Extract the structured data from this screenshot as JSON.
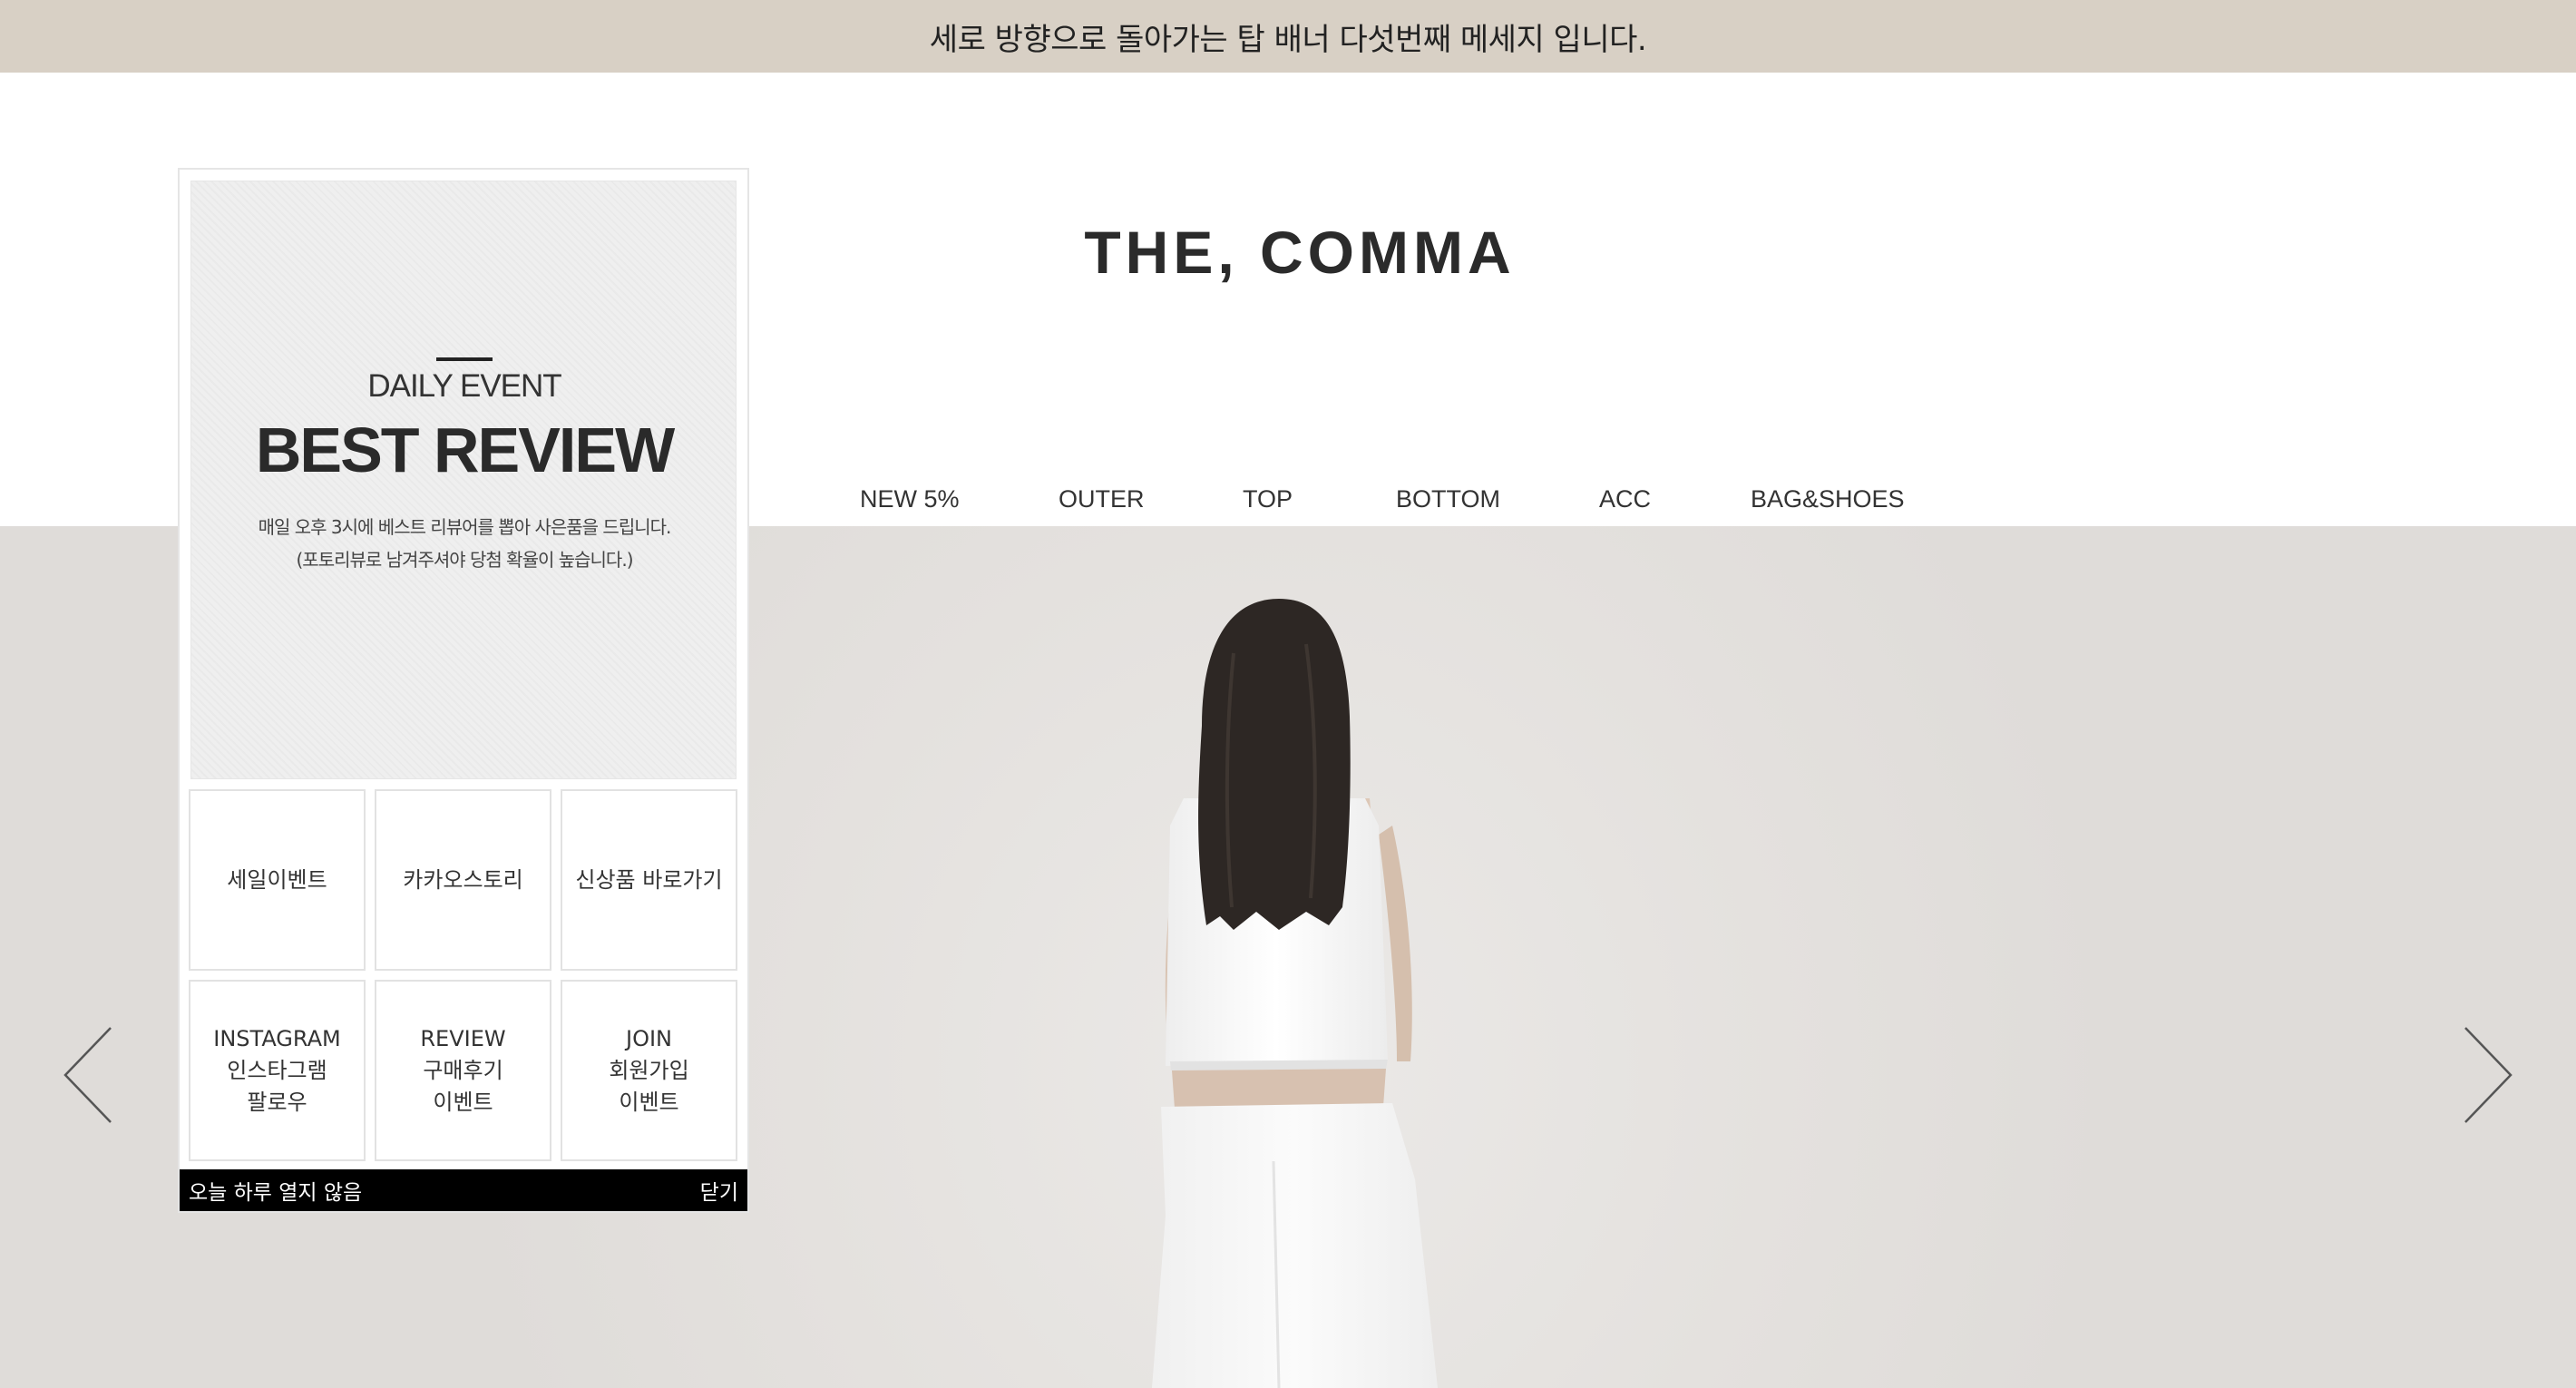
{
  "top_banner": {
    "text": "세로 방향으로 돌아가는 탑 배너 다섯번째 메세지 입니다."
  },
  "header": {
    "logo": "THE, COMMA",
    "nav": [
      {
        "label": "NEW 5%"
      },
      {
        "label": "OUTER"
      },
      {
        "label": "TOP"
      },
      {
        "label": "BOTTOM"
      },
      {
        "label": "ACC"
      },
      {
        "label": "BAG&SHOES"
      }
    ]
  },
  "hero": {
    "prev_icon": "chevron-left-icon",
    "next_icon": "chevron-right-icon",
    "colors": {
      "background": "#e4e1de",
      "arrow": "#555555"
    }
  },
  "popup": {
    "banner": {
      "kicker": "DAILY EVENT",
      "headline": "BEST REVIEW",
      "description": [
        "매일 오후 3시에 베스트 리뷰어를 뽑아 사은품을 드립니다.",
        "(포토리뷰로 남겨주셔야 당첨 확율이 높습니다.)"
      ]
    },
    "grid": [
      {
        "lines": [
          "세일이벤트"
        ]
      },
      {
        "lines": [
          "카카오스토리"
        ]
      },
      {
        "lines": [
          "신상품 바로가기"
        ]
      },
      {
        "lines": [
          "INSTAGRAM",
          "인스타그램",
          "팔로우"
        ]
      },
      {
        "lines": [
          "REVIEW",
          "구매후기",
          "이벤트"
        ]
      },
      {
        "lines": [
          "JOIN",
          "회원가입",
          "이벤트"
        ]
      }
    ],
    "footer": {
      "dont_show_today": "오늘 하루 열지 않음",
      "close": "닫기"
    }
  },
  "colors": {
    "top_banner_bg": "#d8d0c5",
    "popup_footer_bg": "#000000"
  }
}
